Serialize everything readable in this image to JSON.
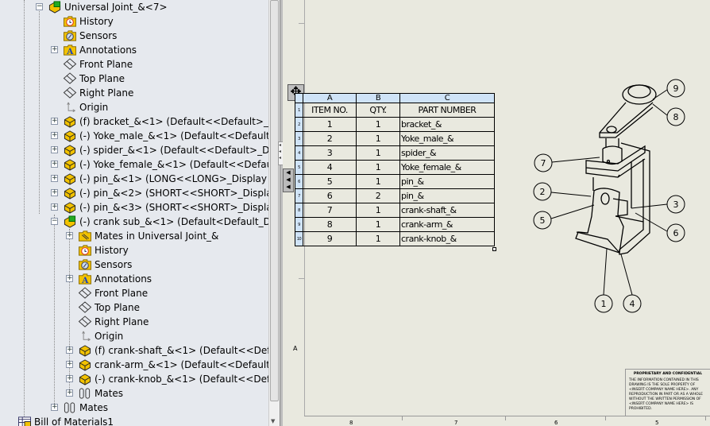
{
  "tree": {
    "items": [
      {
        "label": "Universal Joint_&<7>",
        "level": 0,
        "icon": "assembly-icon",
        "expander": "minus"
      },
      {
        "label": "History",
        "level": 1,
        "icon": "history-folder-icon"
      },
      {
        "label": "Sensors",
        "level": 1,
        "icon": "sensors-folder-icon"
      },
      {
        "label": "Annotations",
        "level": 1,
        "icon": "annotations-folder-icon",
        "expander": "plus"
      },
      {
        "label": "Front Plane",
        "level": 1,
        "icon": "plane-icon"
      },
      {
        "label": "Top Plane",
        "level": 1,
        "icon": "plane-icon"
      },
      {
        "label": "Right Plane",
        "level": 1,
        "icon": "plane-icon"
      },
      {
        "label": "Origin",
        "level": 1,
        "icon": "origin-icon"
      },
      {
        "label": "(f) bracket_&<1> (Default<<Default>_Display",
        "level": 1,
        "icon": "part-icon",
        "expander": "plus"
      },
      {
        "label": "(-) Yoke_male_&<1> (Default<<Default>_Dis",
        "level": 1,
        "icon": "part-icon",
        "expander": "plus"
      },
      {
        "label": "(-) spider_&<1> (Default<<Default>_Display",
        "level": 1,
        "icon": "part-icon",
        "expander": "plus"
      },
      {
        "label": "(-) Yoke_female_&<1> (Default<<Default>_D",
        "level": 1,
        "icon": "part-icon",
        "expander": "plus"
      },
      {
        "label": "(-) pin_&<1> (LONG<<LONG>_Display State",
        "level": 1,
        "icon": "part-icon",
        "expander": "plus"
      },
      {
        "label": "(-) pin_&<2> (SHORT<<SHORT>_Display Sta",
        "level": 1,
        "icon": "part-icon",
        "expander": "plus"
      },
      {
        "label": "(-) pin_&<3> (SHORT<<SHORT>_Display Sta",
        "level": 1,
        "icon": "part-icon",
        "expander": "plus"
      },
      {
        "label": "(-) crank sub_&<1> (Default<Default_Display",
        "level": 1,
        "icon": "assembly-icon",
        "expander": "minus"
      },
      {
        "label": "Mates in Universal Joint_&",
        "level": 2,
        "icon": "mates-folder-icon",
        "expander": "plus"
      },
      {
        "label": "History",
        "level": 2,
        "icon": "history-folder-icon"
      },
      {
        "label": "Sensors",
        "level": 2,
        "icon": "sensors-folder-icon"
      },
      {
        "label": "Annotations",
        "level": 2,
        "icon": "annotations-folder-icon",
        "expander": "plus"
      },
      {
        "label": "Front Plane",
        "level": 2,
        "icon": "plane-icon"
      },
      {
        "label": "Top Plane",
        "level": 2,
        "icon": "plane-icon"
      },
      {
        "label": "Right Plane",
        "level": 2,
        "icon": "plane-icon"
      },
      {
        "label": "Origin",
        "level": 2,
        "icon": "origin-icon"
      },
      {
        "label": "(f) crank-shaft_&<1> (Default<<Default>",
        "level": 2,
        "icon": "part-icon",
        "expander": "plus"
      },
      {
        "label": "crank-arm_&<1> (Default<<Default>_Dis",
        "level": 2,
        "icon": "part-icon",
        "expander": "plus"
      },
      {
        "label": "(-) crank-knob_&<1> (Default<<Default>",
        "level": 2,
        "icon": "part-icon",
        "expander": "plus"
      },
      {
        "label": "Mates",
        "level": 2,
        "icon": "mates-icon",
        "expander": "plus"
      },
      {
        "label": "Mates",
        "level": 1,
        "icon": "mates-icon",
        "expander": "plus"
      },
      {
        "label": "Bill of Materials1",
        "level": -1,
        "icon": "bom-icon"
      }
    ]
  },
  "bom": {
    "col_letters": [
      "A",
      "B",
      "C"
    ],
    "row_numbers": [
      "1",
      "2",
      "3",
      "4",
      "5",
      "6",
      "7",
      "8",
      "9",
      "10"
    ],
    "headers": [
      "ITEM NO.",
      "QTY.",
      "PART NUMBER"
    ],
    "rows": [
      [
        "1",
        "1",
        "bracket_&"
      ],
      [
        "2",
        "1",
        "Yoke_male_&"
      ],
      [
        "3",
        "1",
        "spider_&"
      ],
      [
        "4",
        "1",
        "Yoke_female_&"
      ],
      [
        "5",
        "1",
        "pin_&"
      ],
      [
        "6",
        "2",
        "pin_&"
      ],
      [
        "7",
        "1",
        "crank-shaft_&"
      ],
      [
        "8",
        "1",
        "crank-arm_&"
      ],
      [
        "9",
        "1",
        "crank-knob_&"
      ]
    ]
  },
  "balloons": [
    "9",
    "8",
    "7",
    "2",
    "5",
    "3",
    "6",
    "1",
    "4"
  ],
  "sheet": {
    "zone_row_label": "A",
    "zone_col_labels": [
      "8",
      "7",
      "6",
      "5"
    ]
  },
  "title_block": {
    "heading": "PROPRIETARY AND CONFIDENTIAL",
    "body": "THE INFORMATION CONTAINED IN THIS DRAWING IS THE SOLE PROPERTY OF <INSERT COMPANY NAME HERE>. ANY REPRODUCTION IN PART OR AS A WHOLE WITHOUT THE WRITTEN PERMISSION OF <INSERT COMPANY NAME HERE> IS PROHIBITED."
  },
  "colors": {
    "tree_bg": "#e6e9ee",
    "sheet_bg": "#e9e9df",
    "table_header": "#cfe3f7",
    "folder_yellow": "#f2c200"
  }
}
